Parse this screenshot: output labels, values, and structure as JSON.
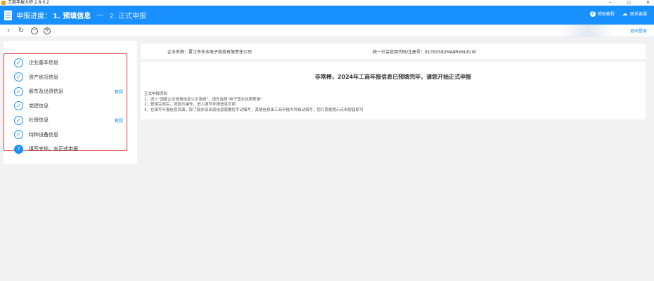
{
  "window": {
    "title": "工商年报大师 2.8.0.2",
    "controls": [
      "–",
      "□",
      "✕"
    ]
  },
  "header": {
    "title": "申报进度：",
    "step_active": "1. 预填信息",
    "separator": "—",
    "step_next": "2. 正式申报",
    "help_label": "帮助教程",
    "contact_label": "联系客服",
    "help_icon": "?",
    "contact_icon": "☁"
  },
  "nav": {
    "back": "‹",
    "refresh": "↻",
    "zoom_out": "−",
    "zoom_in": "+",
    "logout": "退出登录"
  },
  "steps": [
    {
      "label": "企业基本信息",
      "state": "done",
      "mark": "✓",
      "tutorial": ""
    },
    {
      "label": "资产状况信息",
      "state": "done",
      "mark": "✓",
      "tutorial": ""
    },
    {
      "label": "股东及出资信息",
      "state": "done",
      "mark": "✓",
      "tutorial": "教程"
    },
    {
      "label": "党建信息",
      "state": "done",
      "mark": "✓",
      "tutorial": ""
    },
    {
      "label": "社保信息",
      "state": "done",
      "mark": "✓",
      "tutorial": "教程"
    },
    {
      "label": "特种设备信息",
      "state": "done",
      "mark": "✓",
      "tutorial": ""
    },
    {
      "label": "填写完毕，去正式申报",
      "state": "current",
      "mark": "7",
      "tutorial": ""
    }
  ],
  "company": {
    "name_label": "企业名称：",
    "name": "晋江市乐水电子商务有限责任公司",
    "code_label": "统一社会信用代码/注册号：",
    "code": "91350582MA8RX6L81W"
  },
  "main": {
    "congrats": "非常棒，2024年工商年报信息已预填完毕，请您开始正式申报",
    "notice_title": "正式申报须知",
    "notice_items": [
      "1、进入\"国家企业信用信息公示系统\"，请先选择\"电子营业执照登录\"",
      "2、登录完成后，按提示操作，进入填写年报信息页面",
      "3、在填写年报信息页面，除了股东及出资信息需要您手动填写，其他信息由工商年报大师自动填写，您只需按提示点击按钮即可"
    ]
  },
  "colors": {
    "header_blue": "#1890ff",
    "highlight_red": "#e03a3a",
    "link_blue": "#1890ff"
  }
}
